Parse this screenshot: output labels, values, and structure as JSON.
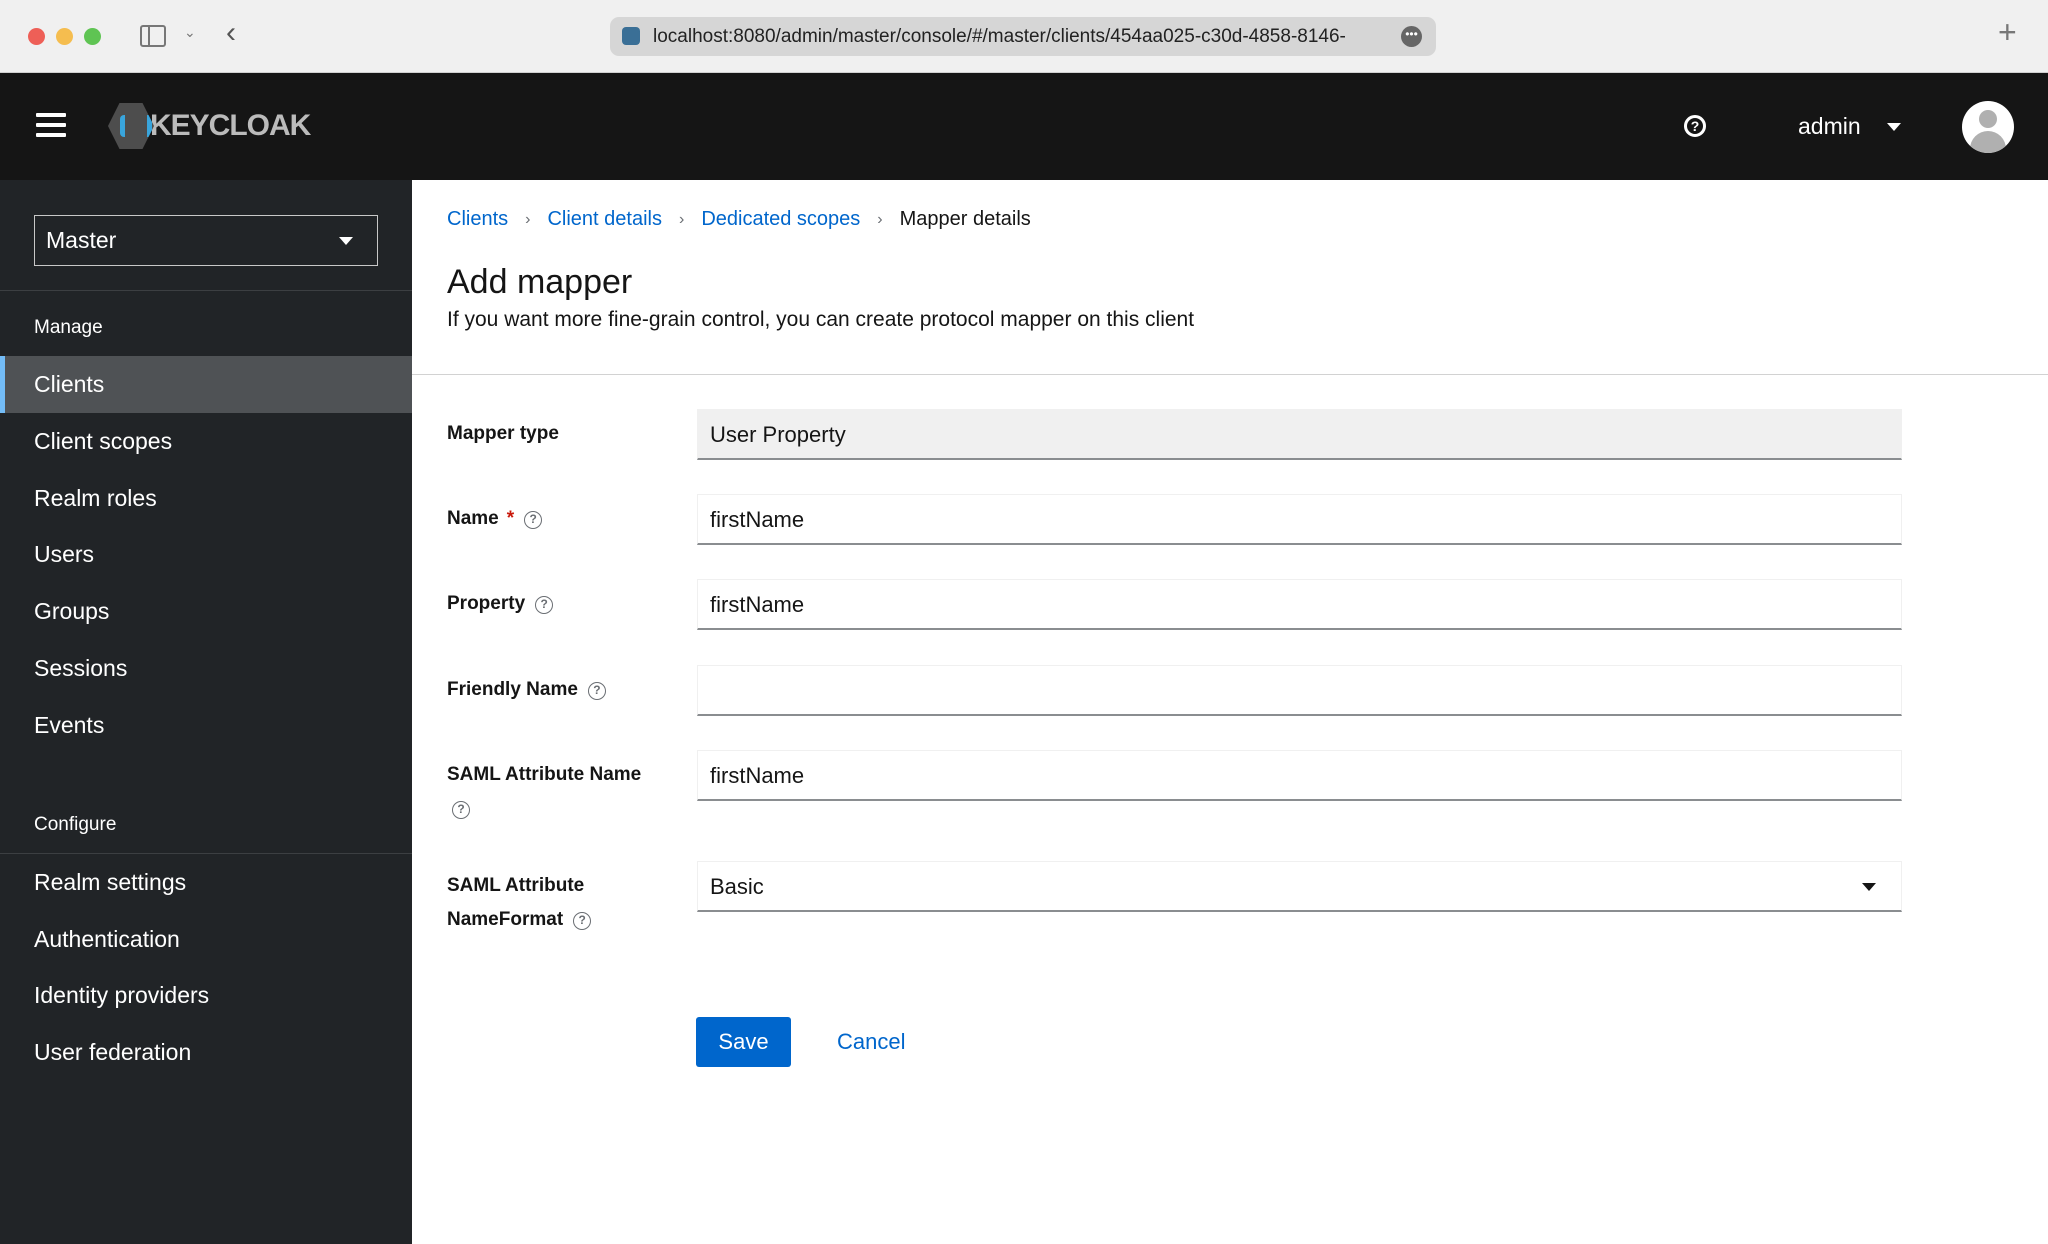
{
  "browser": {
    "url": "localhost:8080/admin/master/console/#/master/clients/454aa025-c30d-4858-8146-"
  },
  "header": {
    "logo": "KEYCLOAK",
    "user": "admin"
  },
  "sidebar": {
    "realm": "Master",
    "manage_label": "Manage",
    "manage_items": [
      {
        "label": "Clients",
        "active": true
      },
      {
        "label": "Client scopes"
      },
      {
        "label": "Realm roles"
      },
      {
        "label": "Users"
      },
      {
        "label": "Groups"
      },
      {
        "label": "Sessions"
      },
      {
        "label": "Events"
      }
    ],
    "configure_label": "Configure",
    "configure_items": [
      {
        "label": "Realm settings"
      },
      {
        "label": "Authentication"
      },
      {
        "label": "Identity providers"
      },
      {
        "label": "User federation"
      }
    ]
  },
  "breadcrumb": [
    "Clients",
    "Client details",
    "Dedicated scopes",
    "Mapper details"
  ],
  "page": {
    "title": "Add mapper",
    "subtitle": "If you want more fine-grain control, you can create protocol mapper on this client"
  },
  "form": {
    "mapper_type": {
      "label": "Mapper type",
      "value": "User Property"
    },
    "name": {
      "label": "Name",
      "required": "*",
      "value": "firstName"
    },
    "property": {
      "label": "Property",
      "value": "firstName"
    },
    "friendly_name": {
      "label": "Friendly Name",
      "value": ""
    },
    "saml_attribute_name": {
      "label": "SAML Attribute Name",
      "value": "firstName"
    },
    "saml_attribute_nameformat": {
      "label_line1": "SAML Attribute",
      "label_line2": "NameFormat",
      "value": "Basic"
    },
    "save": "Save",
    "cancel": "Cancel"
  },
  "colors": {
    "primary": "#0066cc",
    "header_bg": "#151515",
    "sidebar_bg": "#212427",
    "active_accent": "#73bcf7"
  }
}
